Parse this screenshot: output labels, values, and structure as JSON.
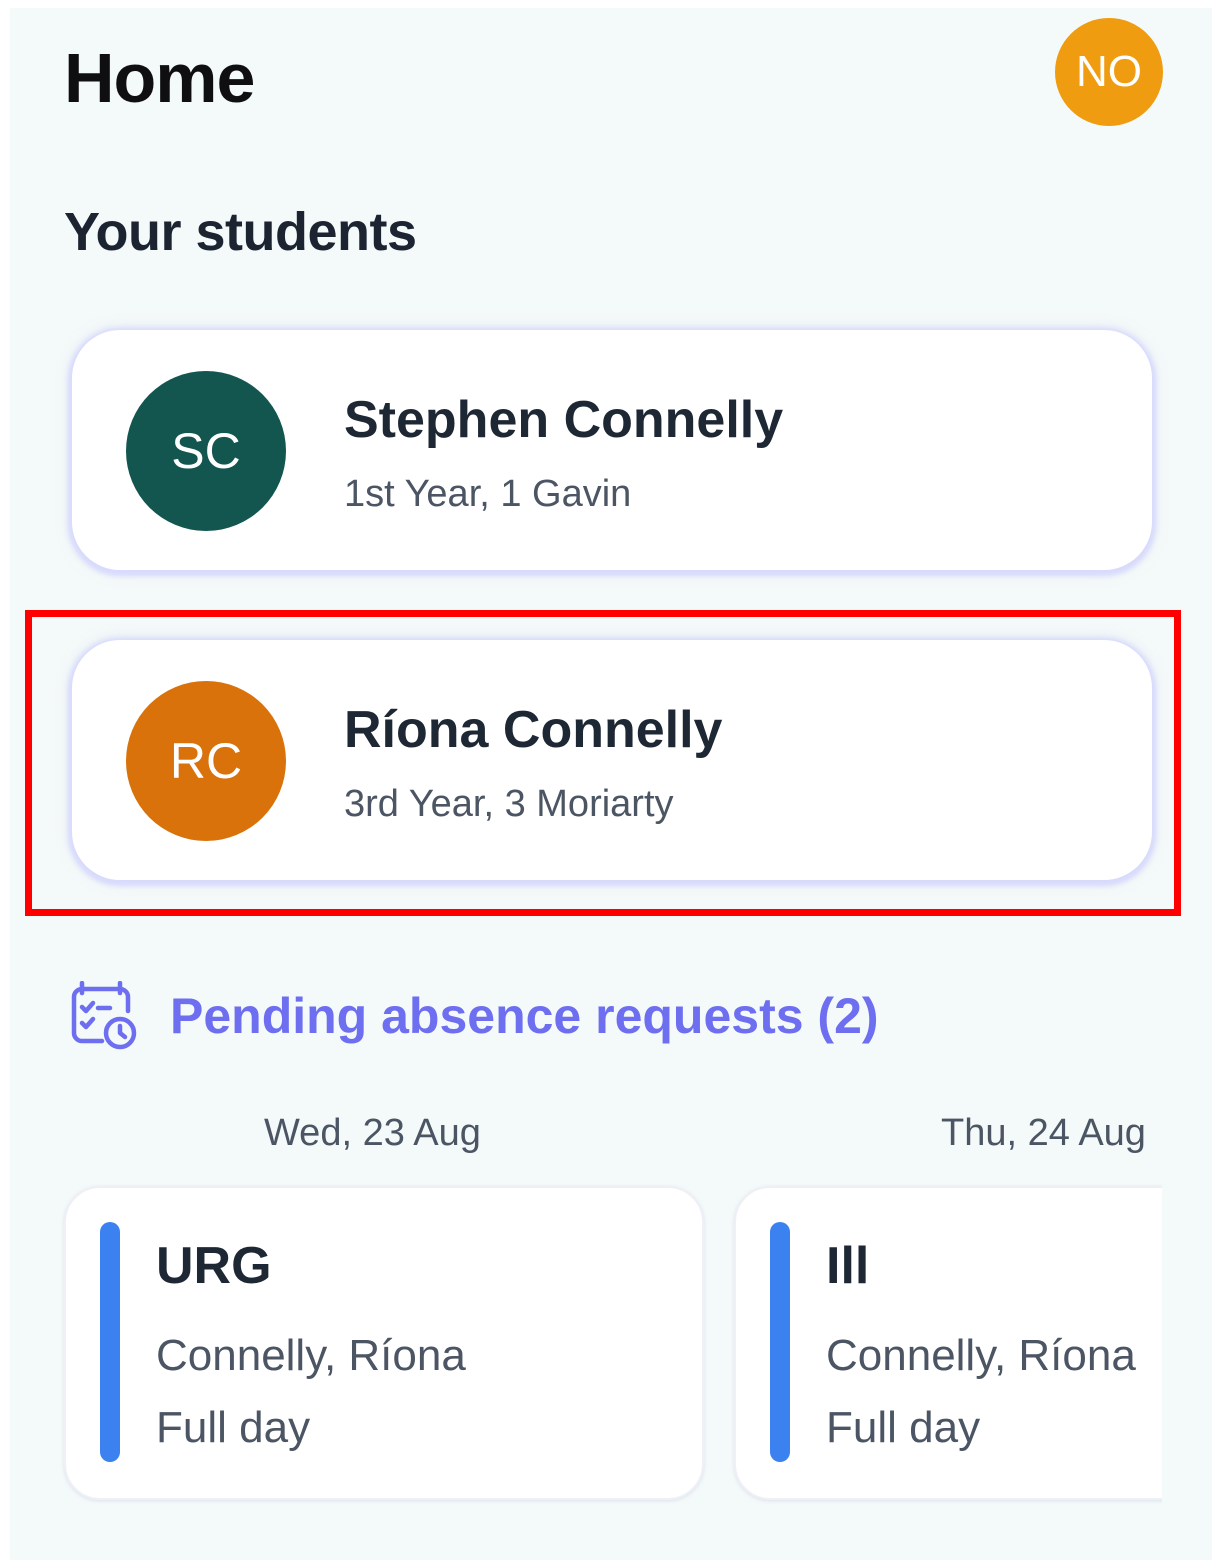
{
  "header": {
    "title": "Home",
    "user_initials": "NO",
    "user_avatar_color": "#f09c10"
  },
  "students_section": {
    "title": "Your students",
    "students": [
      {
        "initials": "SC",
        "name": "Stephen Connelly",
        "class": "1st Year, 1 Gavin",
        "avatar_color": "#12564f"
      },
      {
        "initials": "RC",
        "name": "Ríona Connelly",
        "class": "3rd Year, 3 Moriarty",
        "avatar_color": "#d9720a"
      }
    ]
  },
  "pending": {
    "icon": "calendar-clock-icon",
    "label": "Pending absence requests (2)",
    "accent_color": "#6e6ef0",
    "requests": [
      {
        "date": "Wed, 23 Aug",
        "type": "URG",
        "student": "Connelly, Ríona",
        "duration": "Full day"
      },
      {
        "date": "Thu, 24 Aug",
        "type": "Ill",
        "student": "Connelly, Ríona",
        "duration": "Full day"
      }
    ]
  },
  "highlight_color": "#ff0000"
}
